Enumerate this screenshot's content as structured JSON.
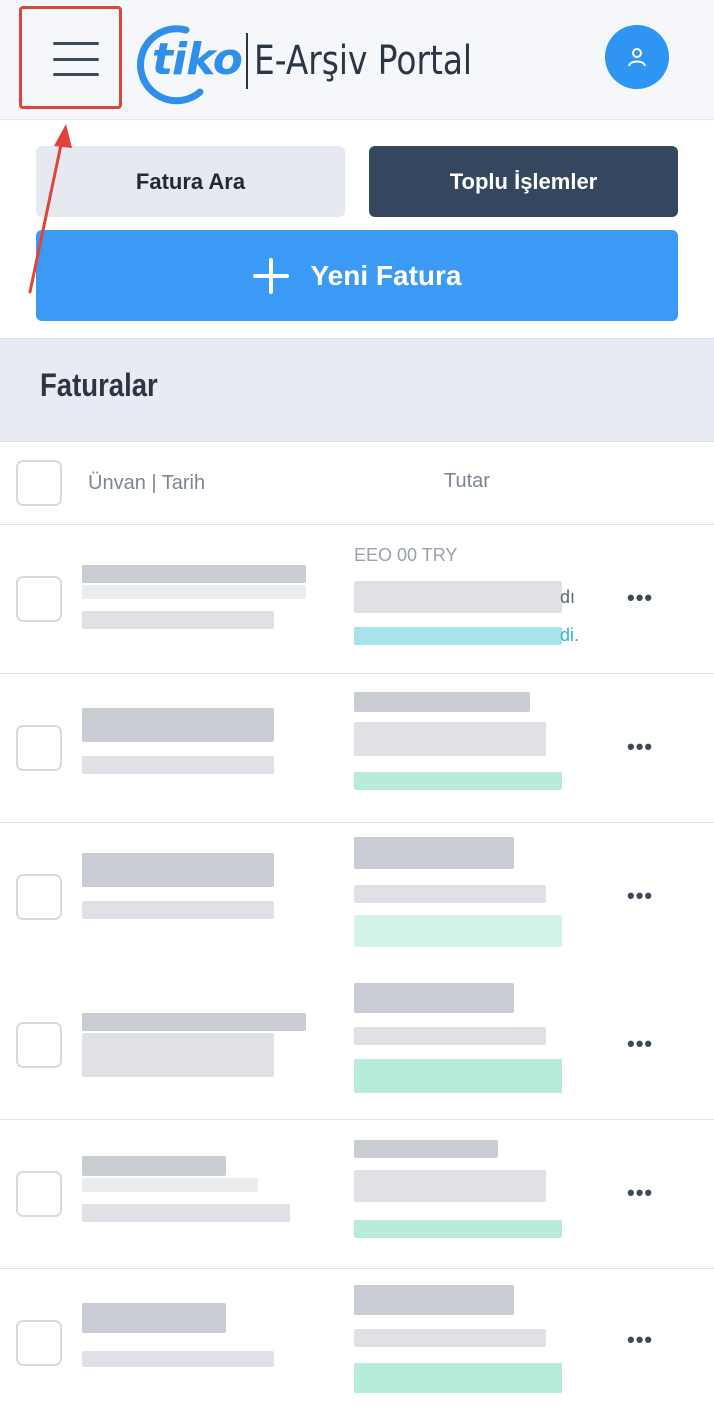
{
  "header": {
    "logo_word": "tiko",
    "logo_product": "E-Arşiv Portal",
    "menu_icon": "hamburger-menu-icon",
    "avatar_icon": "user-icon"
  },
  "actions": {
    "search_label": "Fatura Ara",
    "bulk_label": "Toplu İşlemler",
    "new_label": "Yeni Fatura",
    "new_icon": "plus-icon"
  },
  "section": {
    "title": "Faturalar"
  },
  "table": {
    "col_title_date": "Ünvan | Tarih",
    "col_amount": "Tutar",
    "row_more_icon": "more-horizontal-icon",
    "rows": [
      {
        "amount_partial": "EEO 00 TRY",
        "status_partial_1": "dı",
        "status_partial_2": "di.",
        "more": "•••"
      },
      {
        "more": "•••"
      },
      {
        "more": "•••"
      },
      {
        "more": "•••"
      },
      {
        "more": "•••"
      },
      {
        "more": "•••"
      }
    ]
  },
  "colors": {
    "accent": "#3a9af5",
    "dark_button": "#34475e",
    "highlight": "#e0433b"
  }
}
